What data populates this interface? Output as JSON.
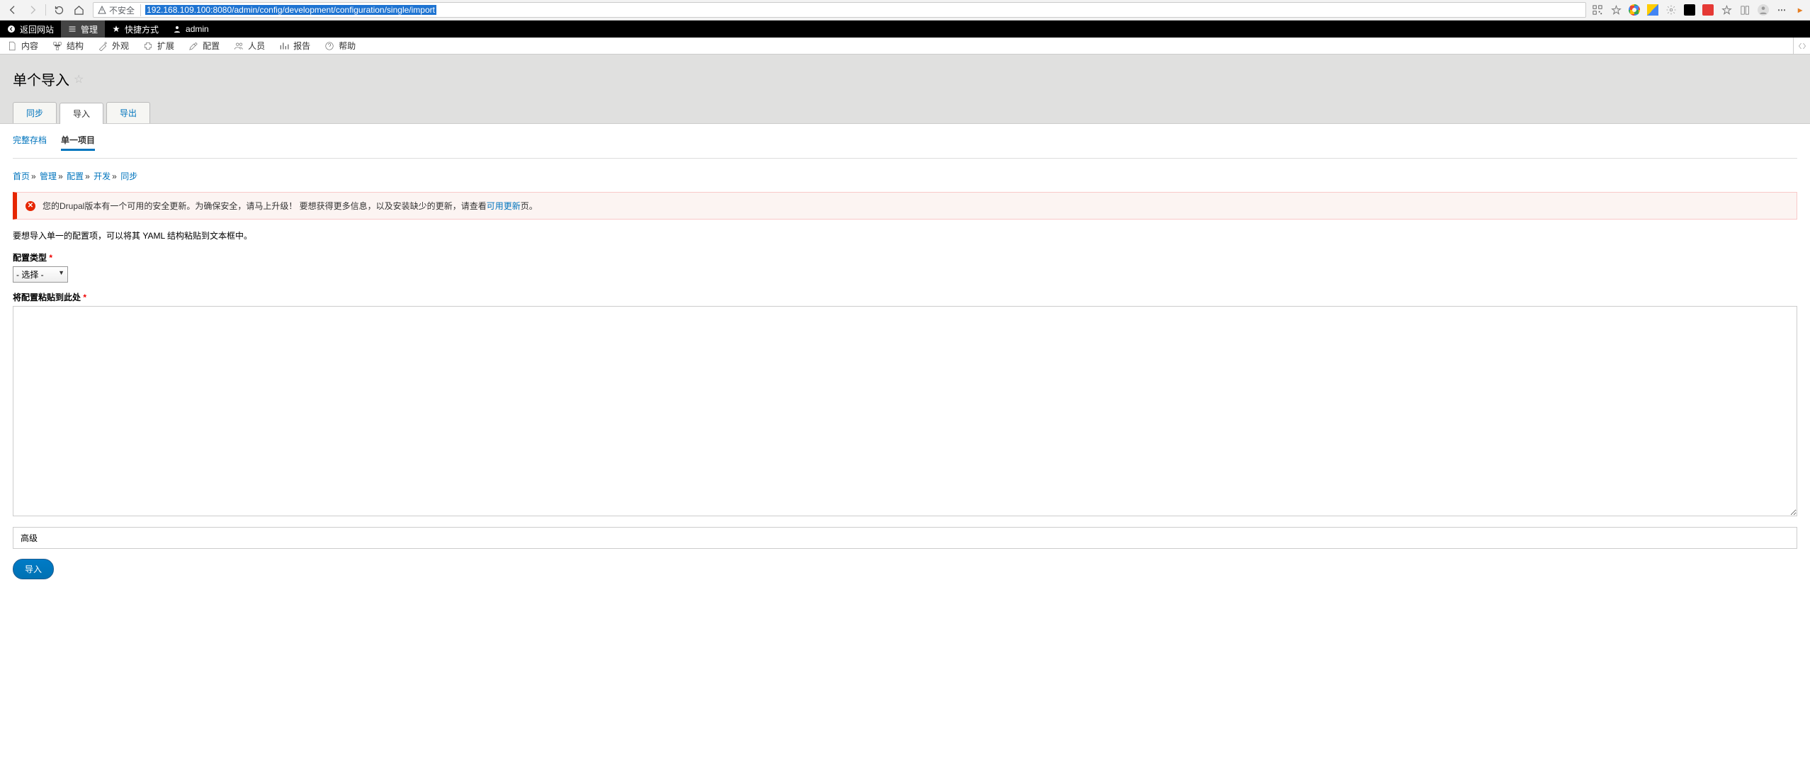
{
  "browser": {
    "not_secure_label": "不安全",
    "url": "192.168.109.100:8080/admin/config/development/configuration/single/import"
  },
  "topbar": {
    "back_to_site": "返回网站",
    "manage": "管理",
    "shortcuts": "快捷方式",
    "user": "admin"
  },
  "admin_menu": {
    "content": "内容",
    "structure": "结构",
    "appearance": "外观",
    "extend": "扩展",
    "config": "配置",
    "people": "人员",
    "reports": "报告",
    "help": "帮助"
  },
  "page": {
    "title": "单个导入",
    "primary_tabs": {
      "sync": "同步",
      "import": "导入",
      "export": "导出"
    },
    "sub_tabs": {
      "full": "完整存档",
      "single": "单一项目"
    },
    "breadcrumb": {
      "home": "首页",
      "admin": "管理",
      "config": "配置",
      "dev": "开发",
      "sync": "同步"
    },
    "alert_text_1": "您的Drupal版本有一个可用的安全更新。为确保安全，请马上升级！ 要想获得更多信息，以及安装缺少的更新，请查看",
    "alert_link": "可用更新",
    "alert_text_2": "页。",
    "description": "要想导入单一的配置项，可以将其 YAML 结构粘贴到文本框中。",
    "config_type_label": "配置类型",
    "config_type_value": "- 选择 -",
    "paste_label": "将配置粘贴到此处",
    "advanced": "高级",
    "submit": "导入"
  }
}
